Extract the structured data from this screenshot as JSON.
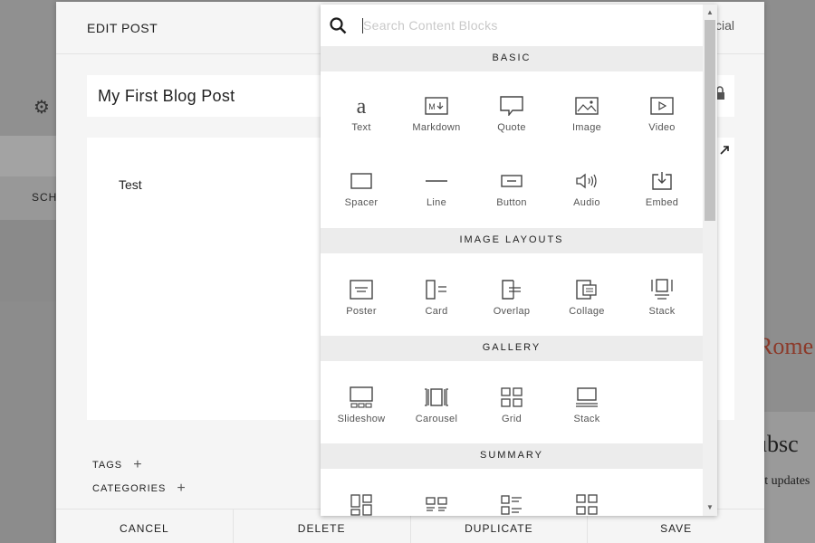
{
  "background": {
    "side_label": "SCH",
    "right_label_red": "Rome",
    "right_label_subscribe": "ubsc",
    "right_label_updates": "et updates",
    "header_right_text": "cial"
  },
  "modal": {
    "title": "EDIT POST",
    "post_title": "My First Blog Post",
    "body_text": "Test",
    "tags_label": "TAGS",
    "categories_label": "CATEGORIES",
    "footer": {
      "cancel": "CANCEL",
      "delete": "DELETE",
      "duplicate": "DUPLICATE",
      "save": "SAVE"
    }
  },
  "picker": {
    "search_placeholder": "Search Content Blocks",
    "sections": {
      "basic": {
        "header": "BASIC",
        "items": [
          {
            "label": "Text",
            "icon": "text-icon"
          },
          {
            "label": "Markdown",
            "icon": "markdown-icon"
          },
          {
            "label": "Quote",
            "icon": "quote-icon"
          },
          {
            "label": "Image",
            "icon": "image-icon"
          },
          {
            "label": "Video",
            "icon": "video-icon"
          },
          {
            "label": "Spacer",
            "icon": "spacer-icon"
          },
          {
            "label": "Line",
            "icon": "line-icon"
          },
          {
            "label": "Button",
            "icon": "button-icon"
          },
          {
            "label": "Audio",
            "icon": "audio-icon"
          },
          {
            "label": "Embed",
            "icon": "embed-icon"
          }
        ]
      },
      "image_layouts": {
        "header": "IMAGE LAYOUTS",
        "items": [
          {
            "label": "Poster",
            "icon": "poster-icon"
          },
          {
            "label": "Card",
            "icon": "card-icon"
          },
          {
            "label": "Overlap",
            "icon": "overlap-icon"
          },
          {
            "label": "Collage",
            "icon": "collage-icon"
          },
          {
            "label": "Stack",
            "icon": "stack-icon"
          }
        ]
      },
      "gallery": {
        "header": "GALLERY",
        "items": [
          {
            "label": "Slideshow",
            "icon": "slideshow-icon"
          },
          {
            "label": "Carousel",
            "icon": "carousel-icon"
          },
          {
            "label": "Grid",
            "icon": "grid-icon"
          },
          {
            "label": "Stack",
            "icon": "gallery-stack-icon"
          }
        ]
      },
      "summary": {
        "header": "SUMMARY",
        "items": [
          {
            "label": "",
            "icon": "summary-wall-icon"
          },
          {
            "label": "",
            "icon": "summary-carousel-icon"
          },
          {
            "label": "",
            "icon": "summary-list-icon"
          },
          {
            "label": "",
            "icon": "summary-grid-icon"
          }
        ]
      }
    }
  }
}
